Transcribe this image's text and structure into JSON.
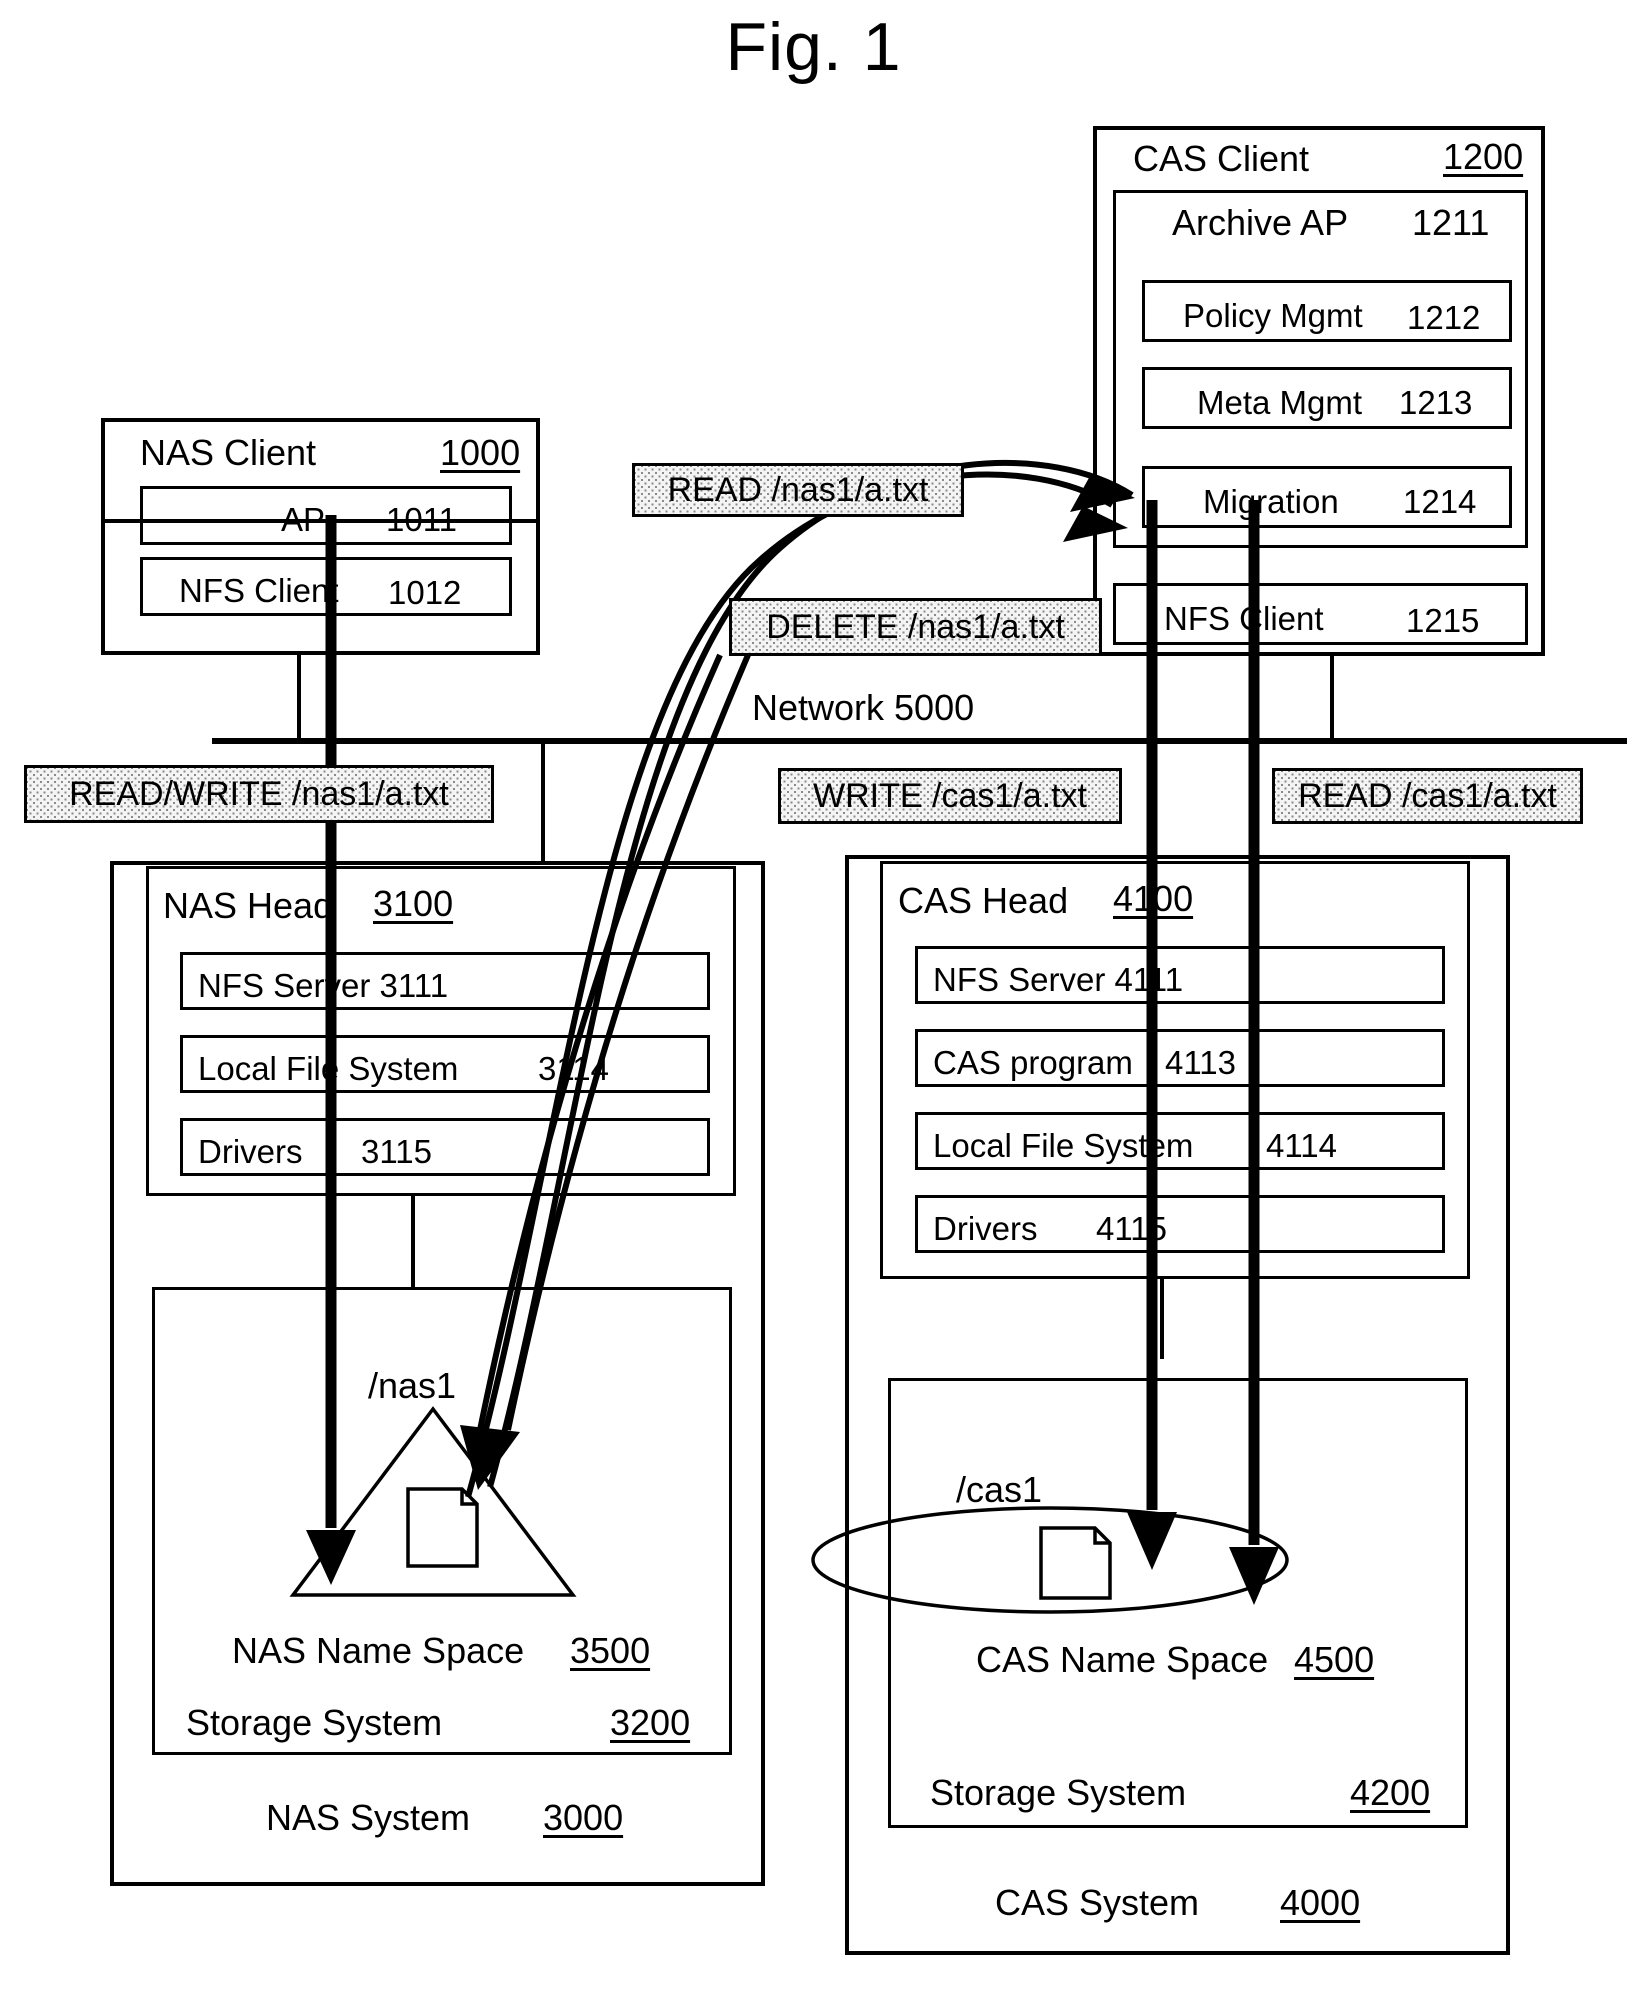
{
  "figure": {
    "title": "Fig. 1"
  },
  "nas_client": {
    "title": "NAS Client",
    "ref": "1000",
    "modules": [
      {
        "label": "AP",
        "ref": "1011"
      },
      {
        "label": "NFS Client",
        "ref": "1012"
      }
    ]
  },
  "cas_client": {
    "title": "CAS Client",
    "ref": "1200",
    "archive_ap": {
      "label": "Archive AP",
      "ref": "1211"
    },
    "archive_modules": [
      {
        "label": "Policy Mgmt",
        "ref": "1212"
      },
      {
        "label": "Meta Mgmt",
        "ref": "1213"
      },
      {
        "label": "Migration",
        "ref": "1214"
      }
    ],
    "nfs_client": {
      "label": "NFS Client",
      "ref": "1215"
    }
  },
  "network": {
    "label": "Network 5000"
  },
  "callouts": {
    "read_nas": "READ /nas1/a.txt",
    "delete_nas": "DELETE /nas1/a.txt",
    "read_write_nas": "READ/WRITE /nas1/a.txt",
    "write_cas": "WRITE /cas1/a.txt",
    "read_cas": "READ /cas1/a.txt"
  },
  "nas_system": {
    "label": "NAS System",
    "ref": "3000",
    "head": {
      "title": "NAS Head",
      "ref": "3100",
      "modules": [
        {
          "label": "NFS Server 3111"
        },
        {
          "label": "Local File System",
          "ref": "3114"
        },
        {
          "label": "Drivers",
          "ref": "3115"
        }
      ]
    },
    "storage": {
      "label": "Storage System",
      "ref": "3200",
      "namespace": {
        "label": "NAS Name Space",
        "ref": "3500",
        "path": "/nas1",
        "shape": "triangle"
      }
    }
  },
  "cas_system": {
    "label": "CAS System",
    "ref": "4000",
    "head": {
      "title": "CAS Head",
      "ref": "4100",
      "modules": [
        {
          "label": "NFS Server 4111"
        },
        {
          "label": "CAS program",
          "ref": "4113"
        },
        {
          "label": "Local File System",
          "ref": "4114"
        },
        {
          "label": "Drivers",
          "ref": "4115"
        }
      ]
    },
    "storage": {
      "label": "Storage System",
      "ref": "4200",
      "namespace": {
        "label": "CAS Name Space",
        "ref": "4500",
        "path": "/cas1",
        "shape": "ellipse"
      }
    }
  },
  "colors": {
    "line": "#000000",
    "callout_fill": "#f4f4f4",
    "background": "#ffffff"
  }
}
